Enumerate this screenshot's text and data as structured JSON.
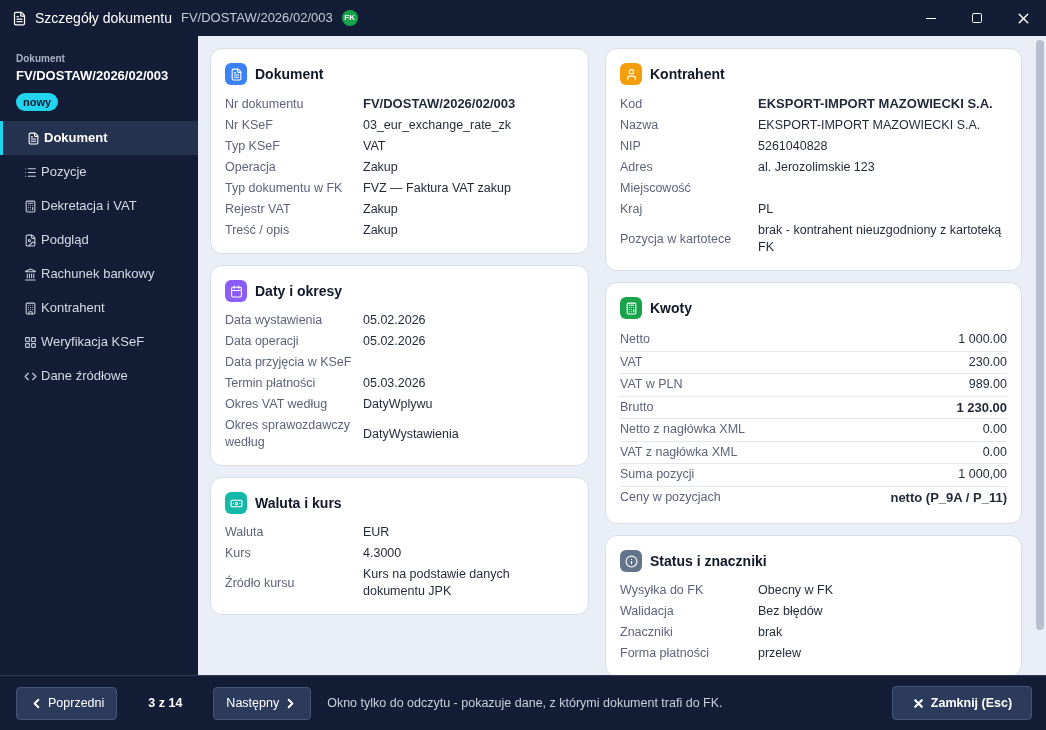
{
  "window": {
    "title": "Szczegóły dokumentu",
    "subtitle": "FV/DOSTAW/2026/02/003",
    "badge": "FK"
  },
  "sidebar": {
    "caption": "Dokument",
    "number": "FV/DOSTAW/2026/02/003",
    "status": "nowy",
    "items": [
      {
        "label": "Dokument",
        "selected": true
      },
      {
        "label": "Pozycje",
        "selected": false
      },
      {
        "label": "Dekretacja i VAT",
        "selected": false
      },
      {
        "label": "Podgląd",
        "selected": false
      },
      {
        "label": "Rachunek bankowy",
        "selected": false
      },
      {
        "label": "Kontrahent",
        "selected": false
      },
      {
        "label": "Weryfikacja KSeF",
        "selected": false
      },
      {
        "label": "Dane źródłowe",
        "selected": false
      }
    ]
  },
  "columns": [
    {
      "cards": [
        {
          "title": "Dokument",
          "kind": "fields",
          "color": "#3b82f6",
          "rows": [
            {
              "label": "Nr dokumentu",
              "value": "FV/DOSTAW/2026/02/003",
              "bold": true
            },
            {
              "label": "Nr KSeF",
              "value": "03_eur_exchange_rate_zk",
              "bold": false
            },
            {
              "label": "Typ KSeF",
              "value": "VAT",
              "bold": false
            },
            {
              "label": "Operacja",
              "value": "Zakup",
              "bold": false
            },
            {
              "label": "Typ dokumentu w FK",
              "value": "FVZ — Faktura VAT zakup",
              "bold": false
            },
            {
              "label": "Rejestr VAT",
              "value": "Zakup",
              "bold": false
            },
            {
              "label": "Treść / opis",
              "value": "Zakup",
              "bold": false
            }
          ]
        },
        {
          "title": "Daty i okresy",
          "kind": "fields",
          "color": "#8b5cf6",
          "rows": [
            {
              "label": "Data wystawienia",
              "value": "05.02.2026",
              "bold": false
            },
            {
              "label": "Data operacji",
              "value": "05.02.2026",
              "bold": false
            },
            {
              "label": "Data przyjęcia w KSeF"
            },
            {
              "label": "Termin płatności",
              "value": "05.03.2026",
              "bold": false
            },
            {
              "label": "Okres VAT według",
              "value": "DatyWplywu",
              "bold": false
            },
            {
              "label": "Okres sprawozdawczy według",
              "value": "DatyWystawienia",
              "bold": false
            }
          ]
        },
        {
          "title": "Waluta i kurs",
          "kind": "fields",
          "color": "#14b8a6",
          "rows": [
            {
              "label": "Waluta",
              "value": "EUR",
              "bold": false
            },
            {
              "label": "Kurs",
              "value": "4.3000",
              "bold": false
            },
            {
              "label": "Źródło kursu",
              "value": "Kurs na podstawie danych dokumentu JPK",
              "bold": false
            }
          ]
        }
      ]
    },
    {
      "cards": [
        {
          "title": "Kontrahent",
          "kind": "fields",
          "color": "#f59e0b",
          "rows": [
            {
              "label": "Kod",
              "value": "EKSPORT-IMPORT MAZOWIECKI S.A.",
              "bold": true
            },
            {
              "label": "Nazwa",
              "value": "EKSPORT-IMPORT MAZOWIECKI S.A.",
              "bold": false
            },
            {
              "label": "NIP",
              "value": "5261040828",
              "bold": false
            },
            {
              "label": "Adres",
              "value": "al. Jerozolimskie 123",
              "bold": false
            },
            {
              "label": "Miejscowość"
            },
            {
              "label": "Kraj",
              "value": "PL",
              "bold": false
            },
            {
              "label": "Pozycja w kartotece",
              "value": "brak - kontrahent nieuzgodniony z kartoteką FK",
              "bold": false
            }
          ]
        },
        {
          "title": "Kwoty",
          "kind": "amounts",
          "color": "#16a34a",
          "rows": [
            {
              "label": "Netto",
              "value": "1 000.00",
              "bold": false
            },
            {
              "label": "VAT",
              "value": "230.00",
              "bold": false
            },
            {
              "label": "VAT w PLN",
              "value": "989.00",
              "bold": false
            },
            {
              "label": "Brutto",
              "value": "1 230.00",
              "bold": true
            },
            {
              "label": "Netto z nagłówka XML",
              "value": "0.00",
              "bold": false
            },
            {
              "label": "VAT z nagłówka XML",
              "value": "0.00",
              "bold": false
            },
            {
              "label": "Suma pozycji",
              "value": "1 000,00",
              "bold": false
            },
            {
              "label": "Ceny w pozycjach",
              "value": "netto (P_9A / P_11)",
              "bold": true
            }
          ]
        },
        {
          "title": "Status i znaczniki",
          "kind": "fields",
          "color": "#64748b",
          "rows": [
            {
              "label": "Wysyłka do FK",
              "value": "Obecny w FK",
              "bold": false
            },
            {
              "label": "Walidacja",
              "value": "Bez błędów",
              "bold": false
            },
            {
              "label": "Znaczniki",
              "value": "brak",
              "bold": false
            },
            {
              "label": "Forma płatności",
              "value": "przelew",
              "bold": false
            }
          ]
        }
      ]
    }
  ],
  "footer": {
    "previous": "Poprzedni",
    "position": "3 z 14",
    "next": "Następny",
    "note": "Okno tylko do odczytu - pokazuje dane, z którymi dokument trafi do FK.",
    "close": "Zamknij (Esc)"
  }
}
